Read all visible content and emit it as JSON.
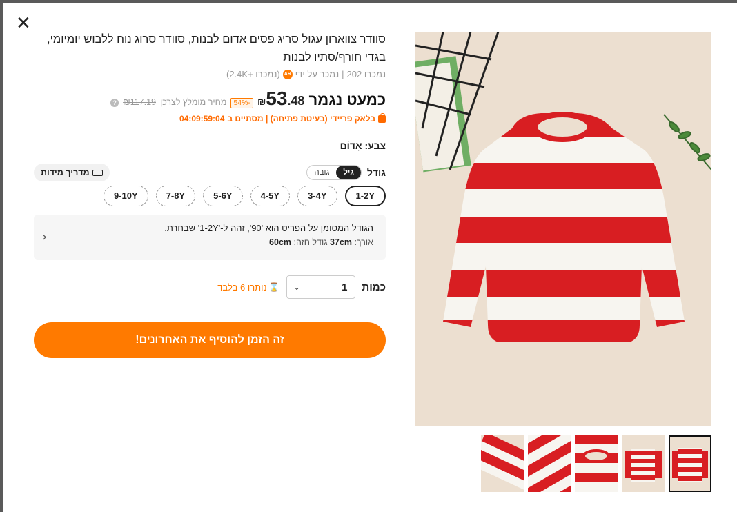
{
  "modal": {
    "close_label": "✕"
  },
  "product": {
    "title": "סוודר צווארון עגול סריג פסים אדום לבנות, סוודר סרוג נוח ללבוש יומיומי, בגדי חורף/סתיו לבנות",
    "sold_count": "נמכרו 202",
    "seller_prefix": "נמכר על ידי",
    "seller_sold": "(נמכרו +2.4K)",
    "seller_badge": "AR"
  },
  "price": {
    "label": "כמעט נגמר",
    "currency": "₪",
    "integer": "53",
    "decimal": ".48",
    "discount": "-54%",
    "recommended_label": "מחיר מומלץ לצרכן",
    "old_price": "₪117.19",
    "help": "?"
  },
  "sale": {
    "text": "בלאק פריידי (בעיטת פתיחה) | מסתיים ב",
    "countdown": "04:09:59:04"
  },
  "color": {
    "label": "צבע: אָדוֹם"
  },
  "size": {
    "label": "גודל",
    "toggle_on": "גיל",
    "toggle_off": "גובה",
    "guide_label": "מדריך מידות",
    "options": [
      "1-2Y",
      "3-4Y",
      "4-5Y",
      "5-6Y",
      "7-8Y",
      "9-10Y"
    ],
    "selected": "1-2Y"
  },
  "fit": {
    "line1": "הגודל המסומן על הפריט הוא '90', זהה ל-'1-2Y' שבחרת.",
    "length_label": "אורך:",
    "length_value": "37cm",
    "chest_label": "גודל חזה:",
    "chest_value": "60cm"
  },
  "quantity": {
    "label": "כמות",
    "value": "1",
    "stock_note": "נותרו 6 בלבד"
  },
  "cta": {
    "label": "זה הזמן להוסיף את האחרונים!"
  },
  "gallery": {
    "thumbnail_count": 5,
    "active_index": 4
  },
  "colors": {
    "accent": "#ff7a00",
    "stripe_red": "#d81e22",
    "stripe_white": "#f7f5f0"
  }
}
